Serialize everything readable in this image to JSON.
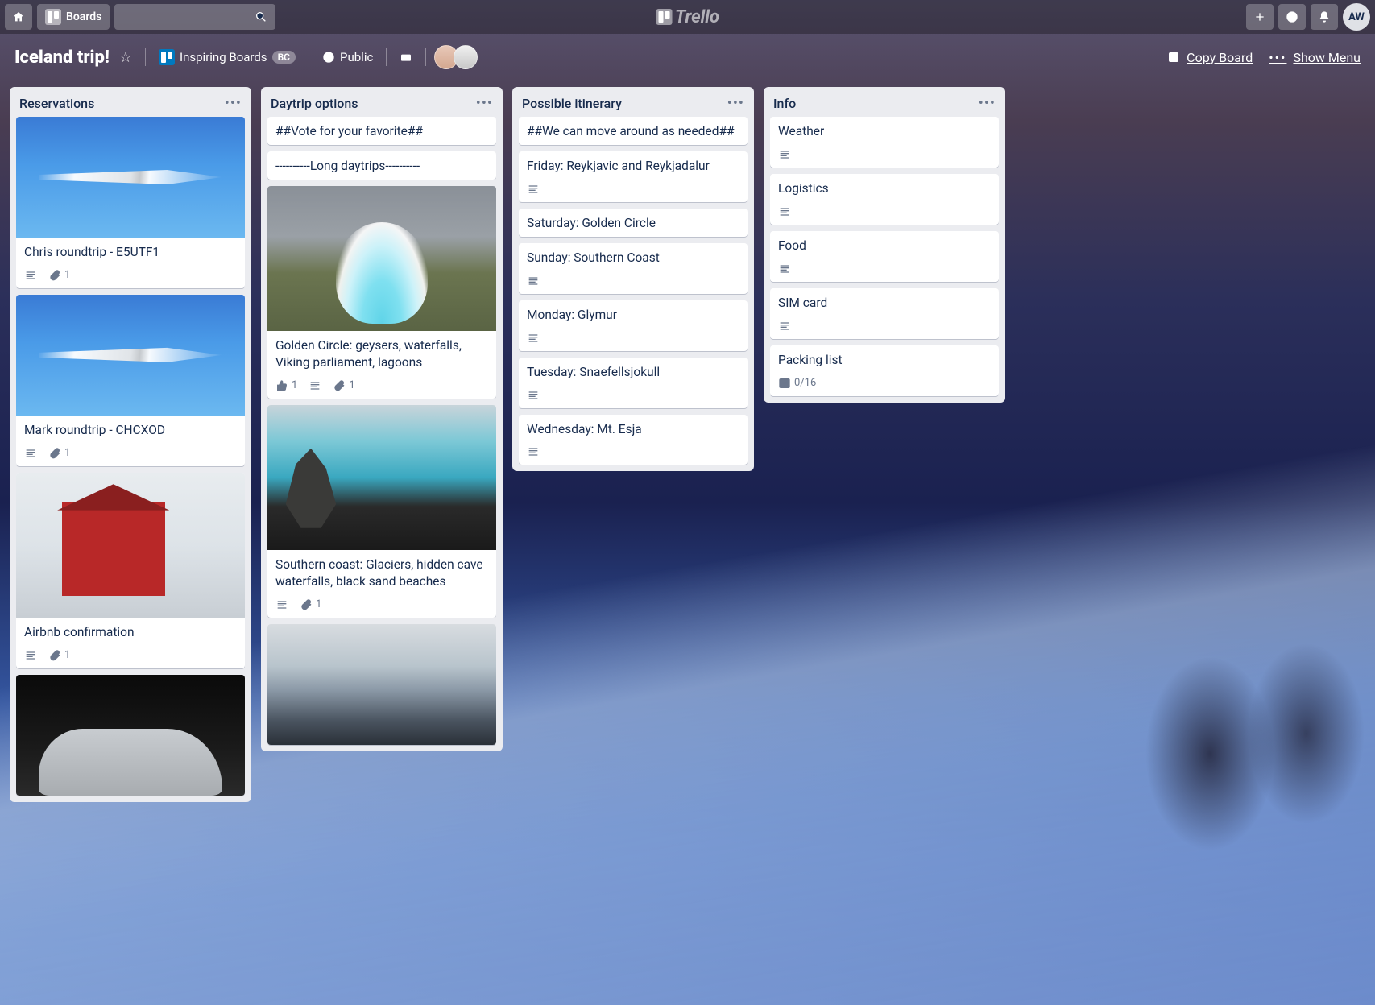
{
  "topbar": {
    "boards_label": "Boards",
    "brand": "Trello",
    "avatar_initials": "AW"
  },
  "board": {
    "title": "Iceland trip!",
    "team_label": "Inspiring Boards",
    "team_tag": "BC",
    "visibility": "Public",
    "copy_label": "Copy Board",
    "menu_label": "Show Menu"
  },
  "lists": [
    {
      "title": "Reservations",
      "cards": [
        {
          "title": "Chris roundtrip - E5UTF1",
          "cover": "plane",
          "badges": {
            "description": true,
            "attachments": 1
          }
        },
        {
          "title": "Mark roundtrip - CHCXOD",
          "cover": "plane",
          "badges": {
            "description": true,
            "attachments": 1
          }
        },
        {
          "title": "Airbnb confirmation",
          "cover": "house",
          "cover_tall": true,
          "badges": {
            "description": true,
            "attachments": 1
          }
        },
        {
          "title": "",
          "cover": "car",
          "cover_only": true,
          "badges": {}
        }
      ]
    },
    {
      "title": "Daytrip options",
      "cards": [
        {
          "title": "##Vote for your favorite##",
          "badges": {}
        },
        {
          "title": "----------Long daytrips----------",
          "badges": {}
        },
        {
          "title": "Golden Circle: geysers, waterfalls, Viking parliament, lagoons",
          "cover": "geyser",
          "cover_tall": true,
          "badges": {
            "votes": 1,
            "description": true,
            "attachments": 1
          }
        },
        {
          "title": "Southern coast: Glaciers, hidden cave waterfalls, black sand beaches",
          "cover": "coast",
          "cover_tall": true,
          "badges": {
            "description": true,
            "attachments": 1
          }
        },
        {
          "title": "",
          "cover": "rocks",
          "cover_only": true,
          "badges": {}
        }
      ]
    },
    {
      "title": "Possible itinerary",
      "cards": [
        {
          "title": "##We can move around as needed##",
          "badges": {}
        },
        {
          "title": "Friday: Reykjavic and Reykjadalur",
          "badges": {
            "description": true
          }
        },
        {
          "title": "Saturday: Golden Circle",
          "badges": {}
        },
        {
          "title": "Sunday: Southern Coast",
          "badges": {
            "description": true
          }
        },
        {
          "title": "Monday: Glymur",
          "badges": {
            "description": true
          }
        },
        {
          "title": "Tuesday: Snaefellsjokull",
          "badges": {
            "description": true
          }
        },
        {
          "title": "Wednesday: Mt. Esja",
          "badges": {
            "description": true
          }
        }
      ]
    },
    {
      "title": "Info",
      "cards": [
        {
          "title": "Weather",
          "badges": {
            "description": true
          }
        },
        {
          "title": "Logistics",
          "badges": {
            "description": true
          }
        },
        {
          "title": "Food",
          "badges": {
            "description": true
          }
        },
        {
          "title": "SIM card",
          "badges": {
            "description": true
          }
        },
        {
          "title": "Packing list",
          "badges": {
            "checklist": "0/16"
          }
        }
      ]
    }
  ]
}
